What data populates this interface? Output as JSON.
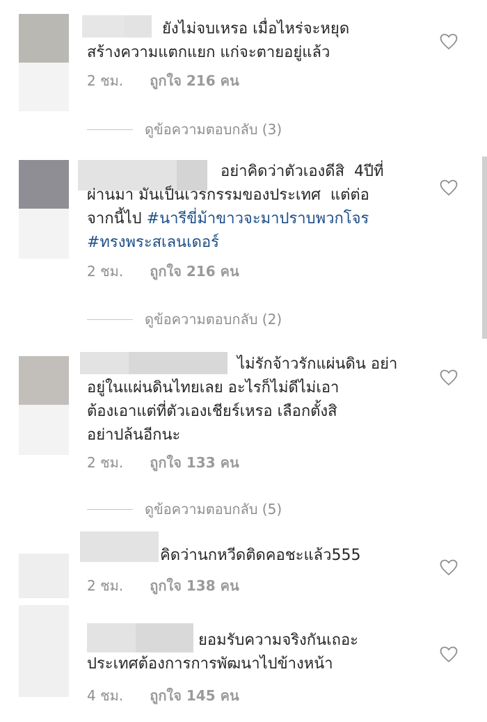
{
  "comments": [
    {
      "text": "ยังไม่จบเหรอ เมื่อไหร่จะหยุด\nสร้างความแตกแยก แก่จะตายอยู่แล้ว",
      "time": "2 ชม.",
      "likes": "ถูกใจ 216 คน",
      "replies": "ดูข้อความตอบกลับ (3)"
    },
    {
      "text": "อย่าคิดว่าตัวเองดีสิ  4ปีที่\nผ่านมา มันเป็นเวรกรรมของประเทศ  แต่ต่อ\nจากนี้ไป ",
      "hashtag1": "#นารีขี่ม้าขาวจะมาปราบพวกโจร",
      "hashtag2": "#ทรงพระสเลนเดอร์",
      "time": "2 ชม.",
      "likes": "ถูกใจ 216 คน",
      "replies": "ดูข้อความตอบกลับ (2)"
    },
    {
      "text": "ไม่รักจ้าวรักแผ่นดิน อย่า\nอยู่ในแผ่นดินไทยเลย อะไรก็ไม่ดีไม่เอา\nต้องเอาแต่ที่ตัวเองเชียร์เหรอ เลือกตั้งสิ\nอย่าปล้นอีกนะ",
      "time": "2 ชม.",
      "likes": "ถูกใจ 133 คน",
      "replies": "ดูข้อความตอบกลับ (5)"
    },
    {
      "text": "คิดว่านกหวีดติดคอชะแล้ว555",
      "time": "2 ชม.",
      "likes": "ถูกใจ 138 คน"
    },
    {
      "text": "ยอมรับความจริงกันเถอะ\nประเทศต้องการการพัฒนาไปข้างหน้า",
      "time": "4 ชม.",
      "likes": "ถูกใจ 145 คน"
    }
  ],
  "colors": {
    "text": "#262626",
    "meta": "#8e8e8e",
    "hashtag": "#1e4f86",
    "heart": "#8e8e8e"
  },
  "icons": {
    "like": "heart-outline-icon"
  }
}
